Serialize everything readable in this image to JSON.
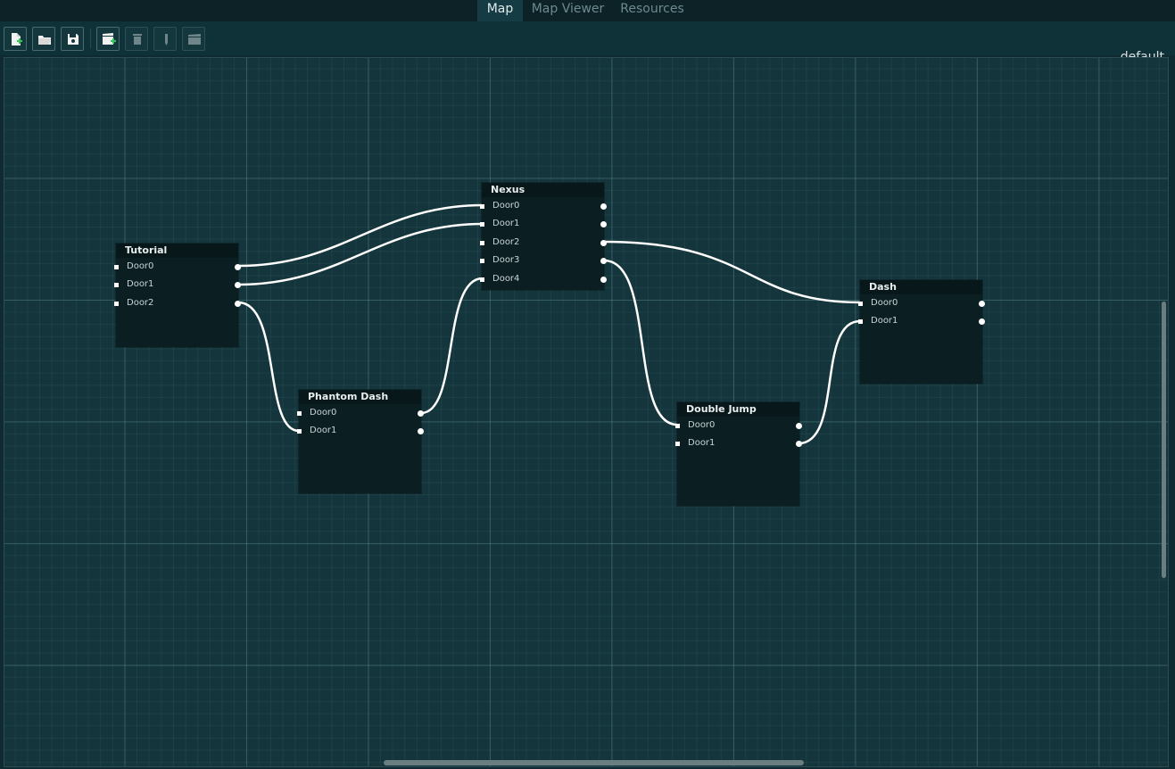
{
  "tabs": [
    {
      "label": "Map",
      "active": true
    },
    {
      "label": "Map Viewer",
      "active": false
    },
    {
      "label": "Resources",
      "active": false
    }
  ],
  "toolbar": {
    "buttons": [
      {
        "icon": "new-file-icon",
        "enabled": true
      },
      {
        "icon": "open-folder-icon",
        "enabled": true
      },
      {
        "icon": "save-icon",
        "enabled": true
      },
      {
        "icon": "add-scene-icon",
        "enabled": true
      },
      {
        "icon": "delete-icon",
        "enabled": false
      },
      {
        "icon": "edit-icon",
        "enabled": false
      },
      {
        "icon": "scene-icon",
        "enabled": false
      }
    ],
    "layout_name": "default"
  },
  "nodes": [
    {
      "id": "tutorial",
      "title": "Tutorial",
      "ports": [
        "Door0",
        "Door1",
        "Door2"
      ]
    },
    {
      "id": "nexus",
      "title": "Nexus",
      "ports": [
        "Door0",
        "Door1",
        "Door2",
        "Door3",
        "Door4"
      ]
    },
    {
      "id": "phantom",
      "title": "Phantom Dash",
      "ports": [
        "Door0",
        "Door1"
      ]
    },
    {
      "id": "double",
      "title": "Double Jump",
      "ports": [
        "Door0",
        "Door1"
      ]
    },
    {
      "id": "dash",
      "title": "Dash",
      "ports": [
        "Door0",
        "Door1"
      ]
    }
  ],
  "connections": [
    {
      "from": "Tutorial.Door0",
      "to": "Nexus.Door0"
    },
    {
      "from": "Tutorial.Door1",
      "to": "Nexus.Door1"
    },
    {
      "from": "Tutorial.Door2",
      "to": "Phantom Dash.Door1"
    },
    {
      "from": "Phantom Dash.Door0",
      "to": "Nexus.Door4"
    },
    {
      "from": "Nexus.Door2",
      "to": "Dash.Door0"
    },
    {
      "from": "Nexus.Door3",
      "to": "Double Jump.Door0"
    },
    {
      "from": "Double Jump.Door1",
      "to": "Dash.Door1"
    }
  ],
  "colors": {
    "background": "#0f2a30",
    "canvas": "#13353b",
    "node_body": "#0b1e22",
    "node_title": "#08171a",
    "wire": "#ffffff",
    "active_tab": "#153c44"
  }
}
